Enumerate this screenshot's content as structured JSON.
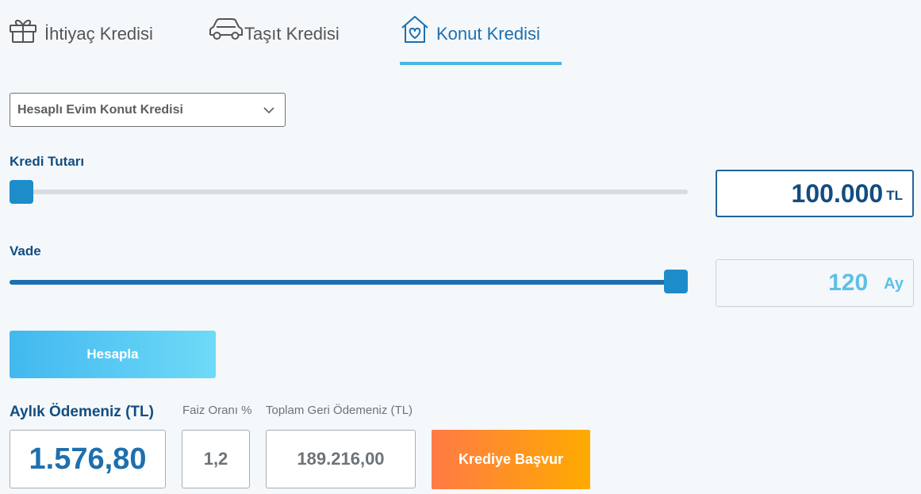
{
  "tabs": [
    {
      "label": "İhtiyaç Kredisi",
      "icon": "gift-icon"
    },
    {
      "label": "Taşıt Kredisi",
      "icon": "car-icon"
    },
    {
      "label": "Konut Kredisi",
      "icon": "house-heart-icon",
      "active": true
    }
  ],
  "loan_type": {
    "selected": "Hesaplı Evim Konut Kredisi"
  },
  "amount": {
    "label": "Kredi Tutarı",
    "value": "100.000",
    "unit": "TL",
    "slider_fraction": 0
  },
  "term": {
    "label": "Vade",
    "value": "120",
    "unit": "Ay",
    "slider_fraction": 1
  },
  "calculate_label": "Hesapla",
  "results": {
    "monthly_label": "Aylık Ödemeniz (TL)",
    "monthly_value": "1.576,80",
    "rate_label": "Faiz Oranı %",
    "rate_value": "1,2",
    "total_label": "Toplam Geri Ödemeniz (TL)",
    "total_value": "189.216,00"
  },
  "apply_label": "Krediye Başvur",
  "colors": {
    "accent": "#1f6fae",
    "tab_underline": "#48b8e0",
    "calc_button_start": "#41b8ef",
    "calc_button_end": "#6fdaf8",
    "apply_button_start": "#ff7a45",
    "apply_button_end": "#ffab00"
  }
}
